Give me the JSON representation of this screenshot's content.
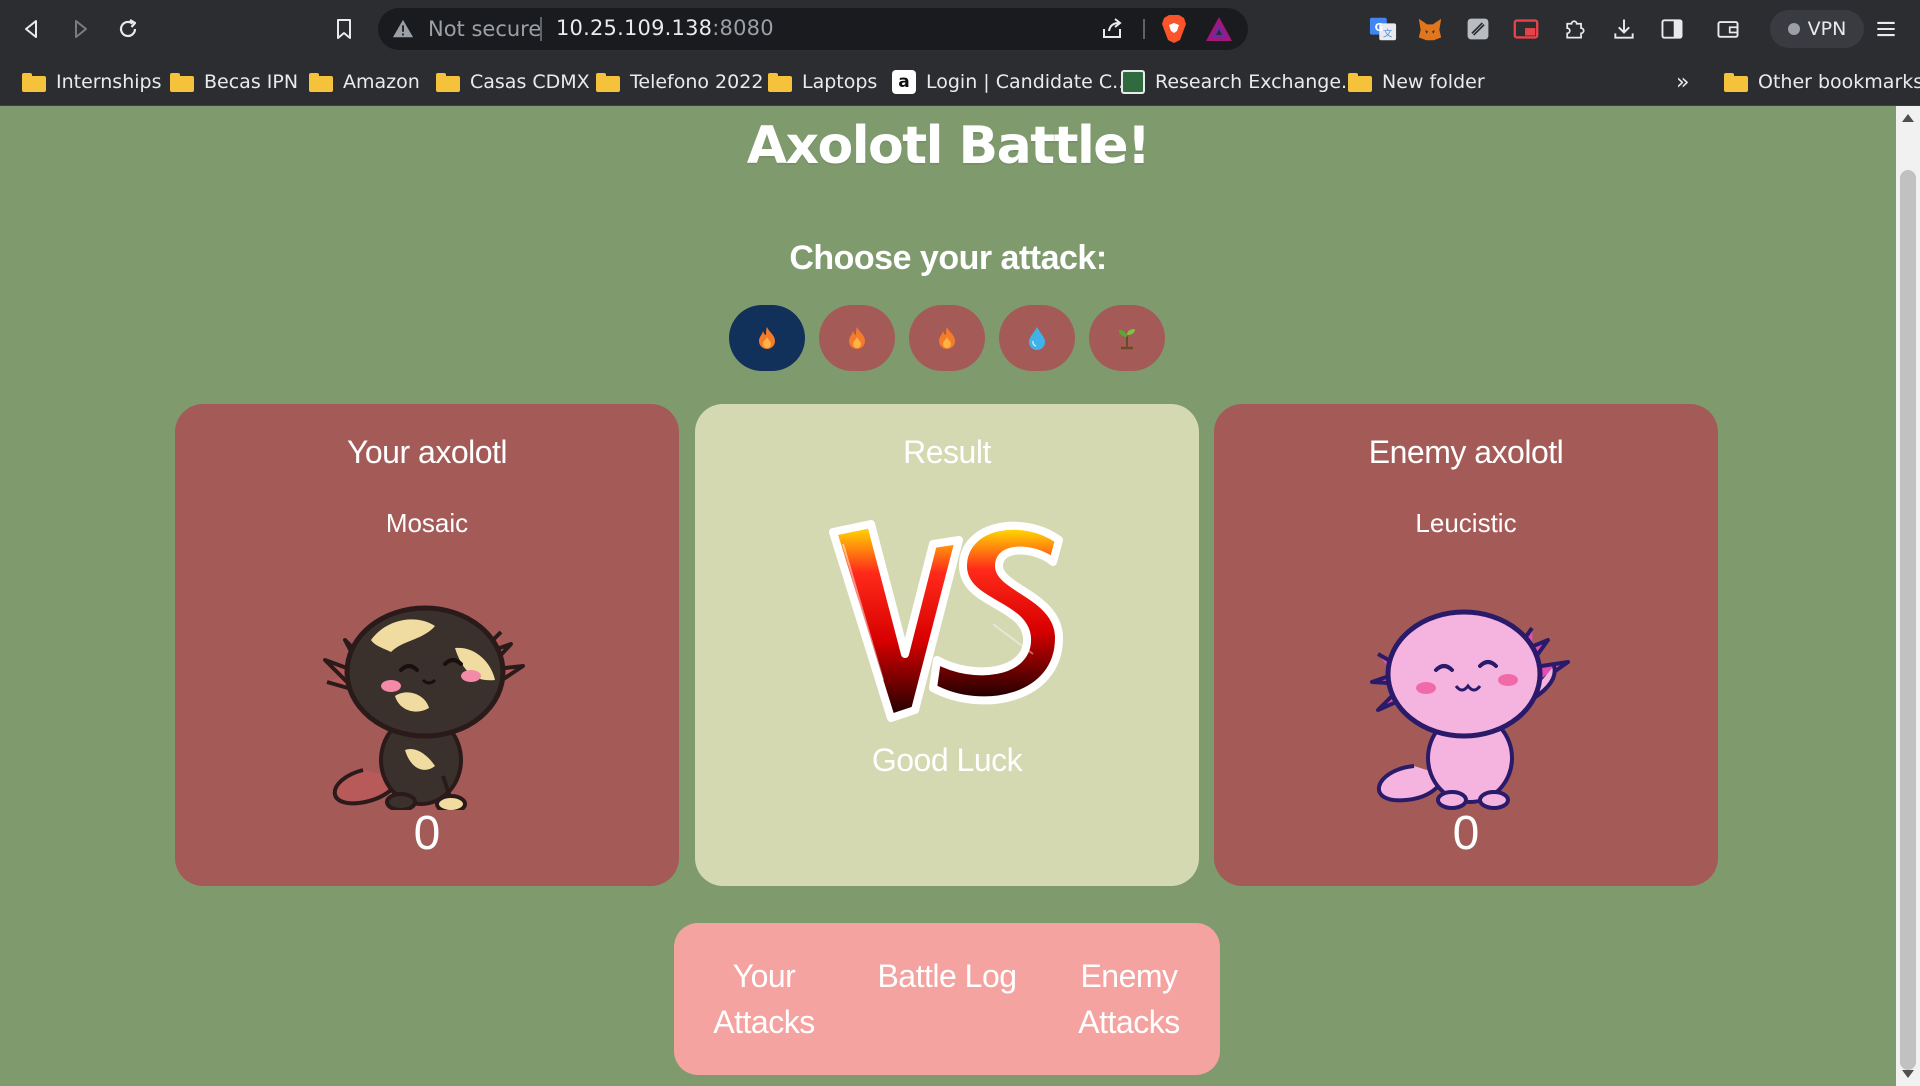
{
  "browser": {
    "omnibox": {
      "security_label": "Not secure",
      "host": "10.25.109.138",
      "port": ":8080"
    },
    "vpn_label": "VPN",
    "bookmarks": [
      {
        "label": "Internships",
        "icon": "folder-icon"
      },
      {
        "label": "Becas IPN",
        "icon": "folder-icon"
      },
      {
        "label": "Amazon",
        "icon": "folder-icon"
      },
      {
        "label": "Casas CDMX",
        "icon": "folder-icon"
      },
      {
        "label": "Telefono 2022",
        "icon": "folder-icon"
      },
      {
        "label": "Laptops",
        "icon": "folder-icon"
      },
      {
        "label": "Login | Candidate C...",
        "icon": "amazon-favicon"
      },
      {
        "label": "Research Exchange...",
        "icon": "research-favicon"
      },
      {
        "label": "New folder",
        "icon": "folder-icon"
      }
    ],
    "bookmarks_overflow": "»",
    "other_bookmarks": "Other bookmarks"
  },
  "game": {
    "title": "Axolotl Battle!",
    "subtitle": "Choose your attack:",
    "attacks": [
      {
        "icon": "fire-icon",
        "color": "#f37b2a",
        "selected": true
      },
      {
        "icon": "fire-icon",
        "color": "#f37b2a",
        "selected": false
      },
      {
        "icon": "fire-icon",
        "color": "#f37b2a",
        "selected": false
      },
      {
        "icon": "water-drop-icon",
        "color": "#3fb3e8",
        "selected": false
      },
      {
        "icon": "sprout-icon",
        "color": "#5aa832",
        "selected": false
      }
    ],
    "player": {
      "title": "Your axolotl",
      "name": "Mosaic",
      "score": "0"
    },
    "result": {
      "title": "Result",
      "message": "Good Luck"
    },
    "enemy": {
      "title": "Enemy axolotl",
      "name": "Leucistic",
      "score": "0"
    },
    "log": {
      "your_attacks_line1": "Your",
      "your_attacks_line2": "Attacks",
      "battle_log": "Battle Log",
      "enemy_attacks_line1": "Enemy",
      "enemy_attacks_line2": "Attacks"
    }
  },
  "colors": {
    "page_bg": "#7f9b6d",
    "card_red": "#a45b58",
    "card_pale": "#d4d9b2",
    "selected_attack": "#11305a",
    "log_panel": "#f5a3a0"
  }
}
